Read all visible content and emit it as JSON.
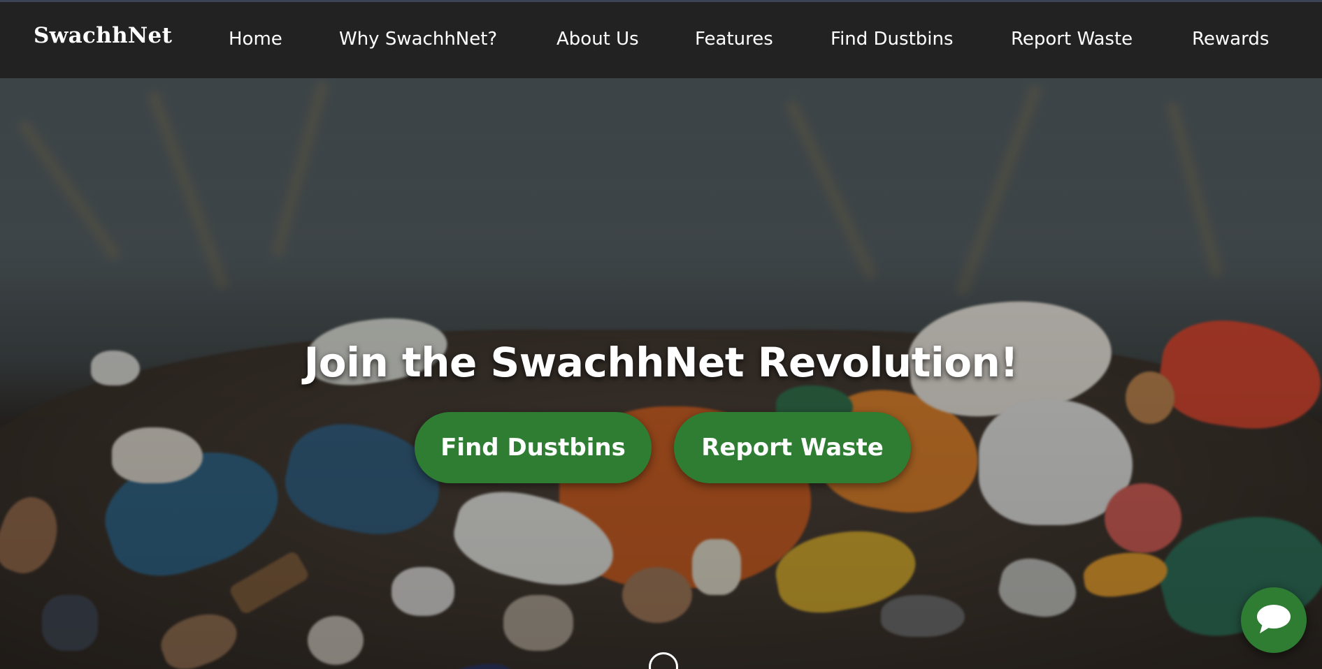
{
  "brand": {
    "name": "SwachhNet"
  },
  "nav": {
    "items": [
      {
        "label": "Home"
      },
      {
        "label": "Why SwachhNet?"
      },
      {
        "label": "About Us"
      },
      {
        "label": "Features"
      },
      {
        "label": "Find Dustbins"
      },
      {
        "label": "Report Waste"
      },
      {
        "label": "Rewards"
      }
    ]
  },
  "hero": {
    "title": "Join the SwachhNet Revolution!",
    "buttons": {
      "find_dustbins": "Find Dustbins",
      "report_waste": "Report Waste"
    },
    "background": "waste-pile-photo"
  },
  "chat": {
    "icon": "chat-bubble-icon"
  },
  "colors": {
    "navbar_bg": "#222222",
    "accent_green": "#2e7d32",
    "text": "#ffffff"
  }
}
